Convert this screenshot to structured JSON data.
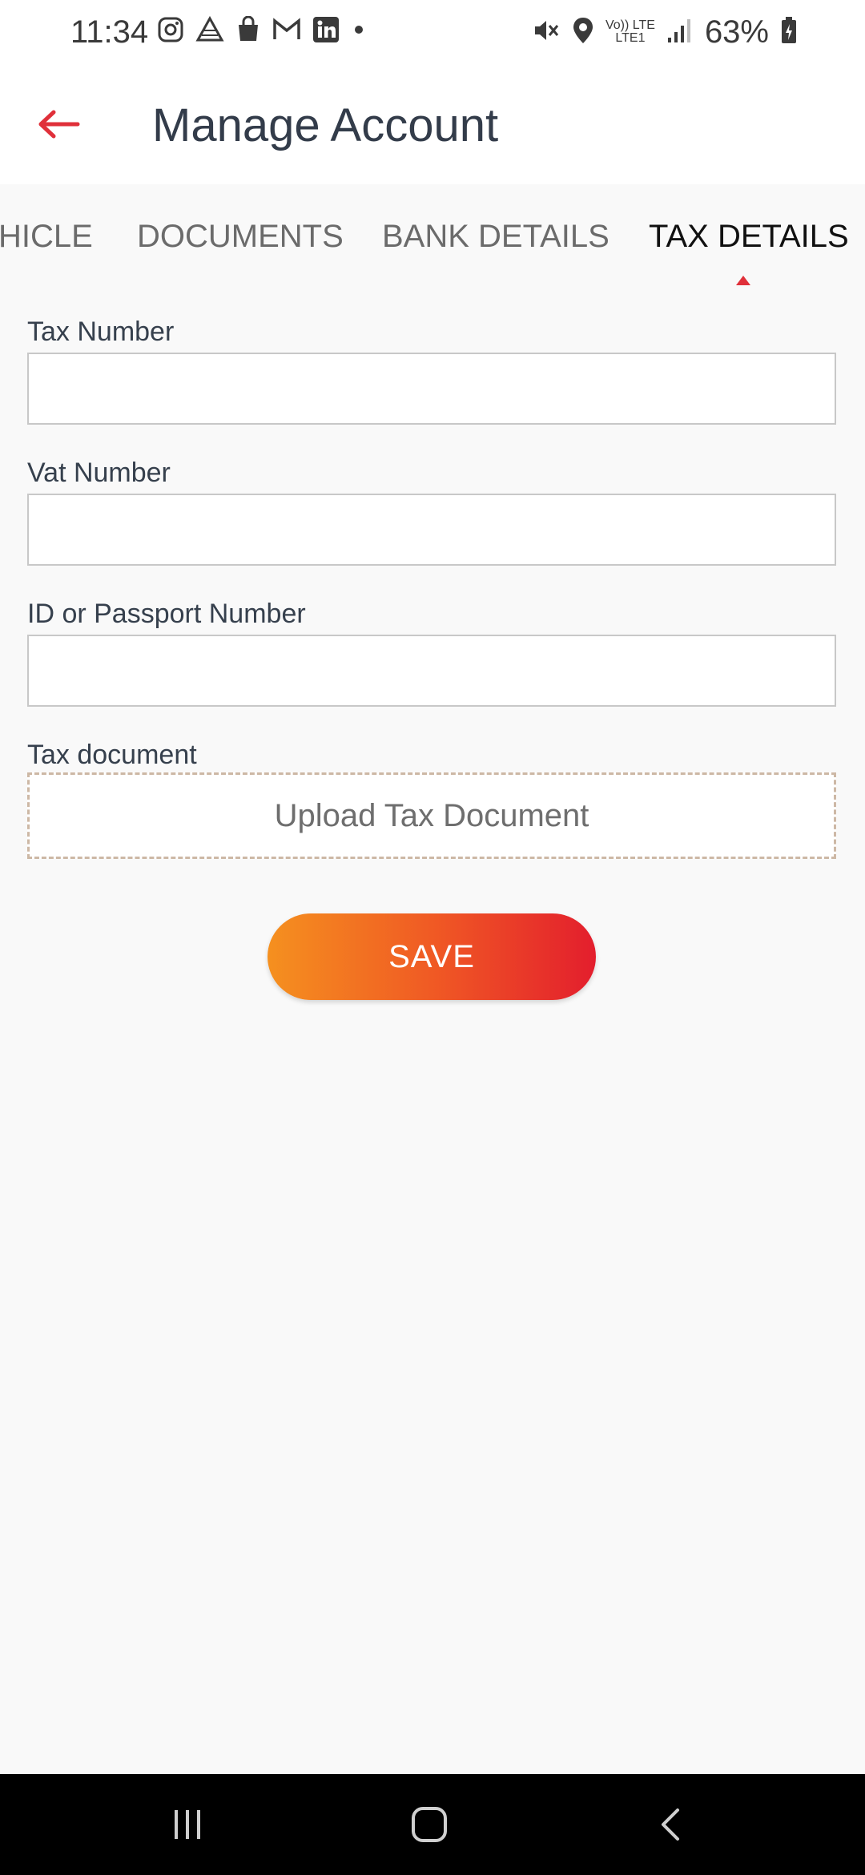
{
  "status_bar": {
    "time": "11:34",
    "battery": "63%",
    "net_top": "Vo)) LTE",
    "net_bottom": "LTE1",
    "left_icons": [
      "instagram-icon",
      "drive-icon",
      "shopping-bag-icon",
      "gmail-icon",
      "linkedin-icon",
      "notification-dot-icon"
    ],
    "right_icons": [
      "mute-icon",
      "location-icon",
      "volte-icon",
      "signal-icon",
      "battery-icon"
    ]
  },
  "header": {
    "title": "Manage Account",
    "back_icon": "back-arrow-icon",
    "accent_color": "#e0303a"
  },
  "tabs": [
    {
      "label": "HICLE",
      "active": false
    },
    {
      "label": "DOCUMENTS",
      "active": false
    },
    {
      "label": "BANK DETAILS",
      "active": false
    },
    {
      "label": "TAX DETAILS",
      "active": true
    }
  ],
  "form": {
    "tax_number": {
      "label": "Tax Number",
      "value": "",
      "placeholder": ""
    },
    "vat_number": {
      "label": "Vat Number",
      "value": "",
      "placeholder": ""
    },
    "id_passport": {
      "label": "ID or Passport Number",
      "value": "",
      "placeholder": ""
    },
    "tax_document": {
      "label": "Tax document",
      "upload_text": "Upload Tax Document"
    },
    "save_label": "SAVE"
  },
  "nav_bar": {
    "icons": [
      "recents-icon",
      "home-icon",
      "back-icon"
    ]
  }
}
